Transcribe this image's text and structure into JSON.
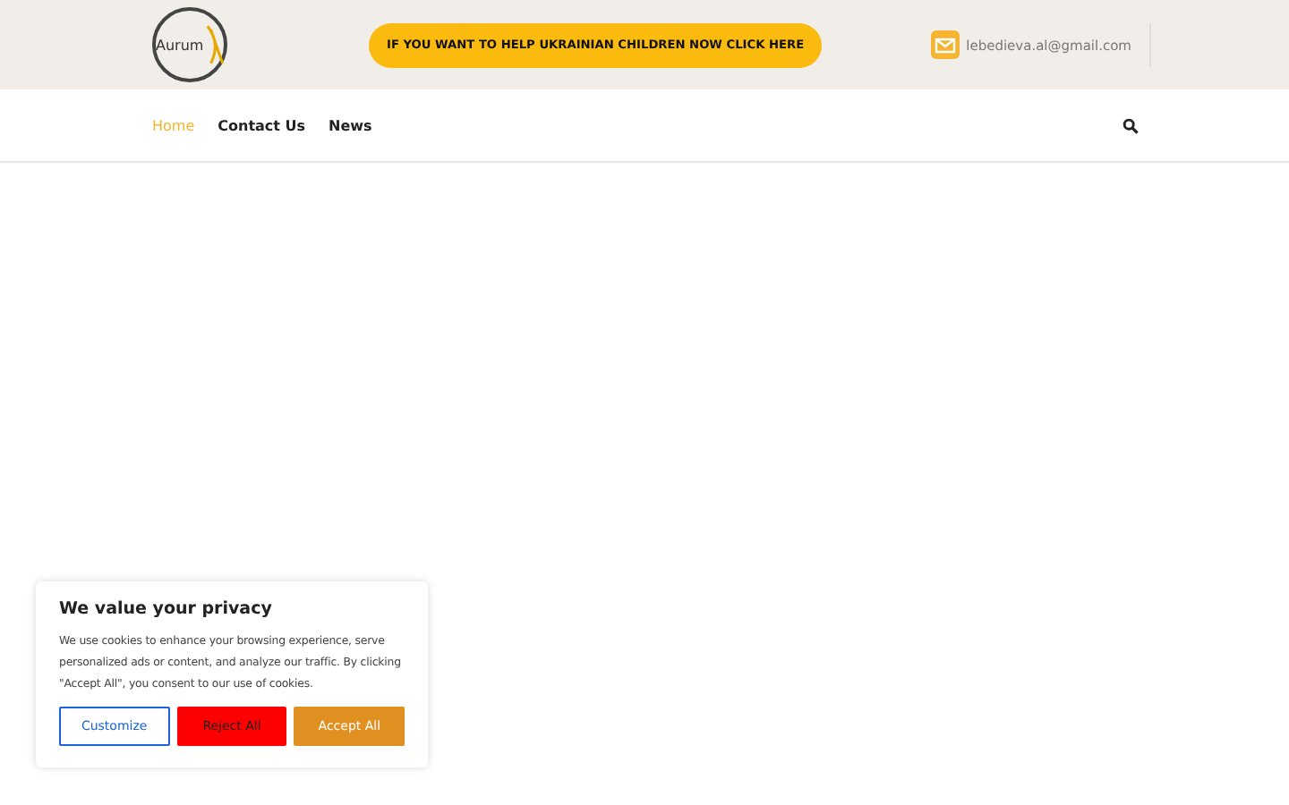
{
  "header": {
    "logo_text": "Aurum",
    "banner_button": "IF YOU WANT TO HELP UKRAINIAN CHILDREN NOW CLICK HERE",
    "email": "lebedieva.al@gmail.com"
  },
  "nav": {
    "items": [
      {
        "label": "Home",
        "selected": true
      },
      {
        "label": "Contact Us",
        "selected": false
      },
      {
        "label": "News",
        "selected": false
      }
    ]
  },
  "cookie_banner": {
    "title": "We value your privacy",
    "text": "We use cookies to enhance your browsing experience, serve personalized ads or content, and analyze our traffic. By clicking \"Accept All\", you consent to our use of cookies.",
    "buttons": [
      {
        "label": "Customize",
        "kind": "outline"
      },
      {
        "label": "Reject All",
        "kind": "reject"
      },
      {
        "label": "Accept All",
        "kind": "accept"
      }
    ]
  }
}
